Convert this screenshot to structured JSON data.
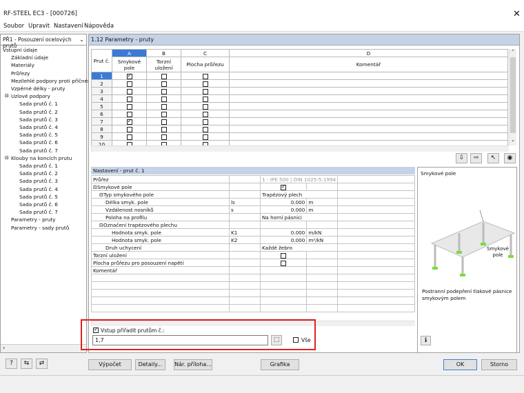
{
  "window": {
    "title": "RF-STEEL EC3 - [000726]",
    "close_label": "✕"
  },
  "menu": {
    "items": [
      "Soubor",
      "Upravit",
      "Nastavení",
      "Nápověda"
    ]
  },
  "nav": {
    "dropdown": "PŘ1 - Posouzení ocelových prutů",
    "tree": [
      {
        "label": "Vstupní údaje",
        "level": 0,
        "prefix": ""
      },
      {
        "label": "Základní údaje",
        "level": 1,
        "prefix": ""
      },
      {
        "label": "Materiály",
        "level": 1,
        "prefix": ""
      },
      {
        "label": "Průřezy",
        "level": 1,
        "prefix": ""
      },
      {
        "label": "Mezilehlé podpory proti příčném",
        "level": 1,
        "prefix": ""
      },
      {
        "label": "Vzpěrné délky - pruty",
        "level": 1,
        "prefix": ""
      },
      {
        "label": "Uzlové podpory",
        "level": 1,
        "prefix": "⊟"
      },
      {
        "label": "Sada prutů č. 1",
        "level": 2,
        "prefix": ""
      },
      {
        "label": "Sada prutů č. 2",
        "level": 2,
        "prefix": ""
      },
      {
        "label": "Sada prutů č. 3",
        "level": 2,
        "prefix": ""
      },
      {
        "label": "Sada prutů č. 4",
        "level": 2,
        "prefix": ""
      },
      {
        "label": "Sada prutů č. 5",
        "level": 2,
        "prefix": ""
      },
      {
        "label": "Sada prutů č. 6",
        "level": 2,
        "prefix": ""
      },
      {
        "label": "Sada prutů č. 7",
        "level": 2,
        "prefix": ""
      },
      {
        "label": "Klouby na koncích prutu",
        "level": 1,
        "prefix": "⊟"
      },
      {
        "label": "Sada prutů č. 1",
        "level": 2,
        "prefix": ""
      },
      {
        "label": "Sada prutů č. 2",
        "level": 2,
        "prefix": ""
      },
      {
        "label": "Sada prutů č. 3",
        "level": 2,
        "prefix": ""
      },
      {
        "label": "Sada prutů č. 4",
        "level": 2,
        "prefix": ""
      },
      {
        "label": "Sada prutů č. 5",
        "level": 2,
        "prefix": ""
      },
      {
        "label": "Sada prutů č. 6",
        "level": 2,
        "prefix": ""
      },
      {
        "label": "Sada prutů č. 7",
        "level": 2,
        "prefix": ""
      },
      {
        "label": "Parametry - pruty",
        "level": 1,
        "prefix": ""
      },
      {
        "label": "Parametry - sady prutů",
        "level": 1,
        "prefix": ""
      }
    ]
  },
  "section": {
    "title": "1.12 Parametry - pruty"
  },
  "grid": {
    "col_letters": [
      "A",
      "B",
      "C",
      "D"
    ],
    "rowhead": "Prut č.",
    "headers": [
      "Smykové pole",
      "Torzní uložení",
      "Plocha průřezu",
      "Komentář"
    ],
    "rows": [
      {
        "n": "1",
        "a": true,
        "b": false,
        "c": false,
        "sel": true
      },
      {
        "n": "2",
        "a": false,
        "b": false,
        "c": false,
        "sel": false
      },
      {
        "n": "3",
        "a": false,
        "b": false,
        "c": false,
        "sel": false
      },
      {
        "n": "4",
        "a": false,
        "b": false,
        "c": false,
        "sel": false
      },
      {
        "n": "5",
        "a": false,
        "b": false,
        "c": false,
        "sel": false
      },
      {
        "n": "6",
        "a": false,
        "b": false,
        "c": false,
        "sel": false
      },
      {
        "n": "7",
        "a": true,
        "b": false,
        "c": false,
        "sel": false
      },
      {
        "n": "8",
        "a": false,
        "b": false,
        "c": false,
        "sel": false
      },
      {
        "n": "9",
        "a": false,
        "b": false,
        "c": false,
        "sel": false
      },
      {
        "n": "10",
        "a": false,
        "b": false,
        "c": false,
        "sel": false
      }
    ]
  },
  "settings": {
    "header": "Nastavení - prut č. 1",
    "rows": [
      {
        "label": "Průřez",
        "sym": "",
        "value": "1 - IPE 500 | DIN 1025-5:1994",
        "unit": "",
        "indent": 0,
        "pre": "",
        "grey": true
      },
      {
        "label": "Smykové pole",
        "sym": "",
        "value": "",
        "unit": "",
        "indent": 0,
        "pre": "⊟",
        "check": true
      },
      {
        "label": "Typ smykového pole",
        "sym": "",
        "value": "Trapézový plech",
        "unit": "",
        "indent": 1,
        "pre": "⊟"
      },
      {
        "label": "Délka smyk. pole",
        "sym": "ls",
        "value": "0.000",
        "unit": "m",
        "indent": 2,
        "pre": ""
      },
      {
        "label": "Vzdálenost nosníků",
        "sym": "s",
        "value": "0.000",
        "unit": "m",
        "indent": 2,
        "pre": ""
      },
      {
        "label": "Poloha na profilu",
        "sym": "",
        "value": "Na horní pásnici",
        "unit": "",
        "indent": 2,
        "pre": ""
      },
      {
        "label": "Označení trapézového plechu",
        "sym": "",
        "value": "",
        "unit": "",
        "indent": 1,
        "pre": "⊟"
      },
      {
        "label": "Hodnota smyk. pole",
        "sym": "K1",
        "value": "0.000",
        "unit": "m/kN",
        "indent": 3,
        "pre": ""
      },
      {
        "label": "Hodnota smyk. pole",
        "sym": "K2",
        "value": "0.000",
        "unit": "m²/kN",
        "indent": 3,
        "pre": ""
      },
      {
        "label": "Druh uchycení",
        "sym": "",
        "value": "Každé žebro",
        "unit": "",
        "indent": 2,
        "pre": ""
      },
      {
        "label": "Torzní uložení",
        "sym": "",
        "value": "",
        "unit": "",
        "indent": 0,
        "pre": "",
        "check": false
      },
      {
        "label": "Plocha průřezu pro posouzení napětí",
        "sym": "",
        "value": "",
        "unit": "",
        "indent": 0,
        "pre": "",
        "check": false
      },
      {
        "label": "Komentář",
        "sym": "",
        "value": "",
        "unit": "",
        "indent": 0,
        "pre": ""
      }
    ]
  },
  "preview": {
    "title": "Smykové pole",
    "callout": "Smykové pole",
    "caption": "Postranní podepření tlakové pásnice smykovým polem"
  },
  "assign": {
    "label": "Vstup přiřadit prutům č.:",
    "value": "1,7",
    "all_label": "Vše"
  },
  "buttons": {
    "calc": "Výpočet",
    "details": "Detaily...",
    "annex": "Nár. příloha...",
    "graphics": "Grafika",
    "ok": "OK",
    "cancel": "Storno"
  }
}
